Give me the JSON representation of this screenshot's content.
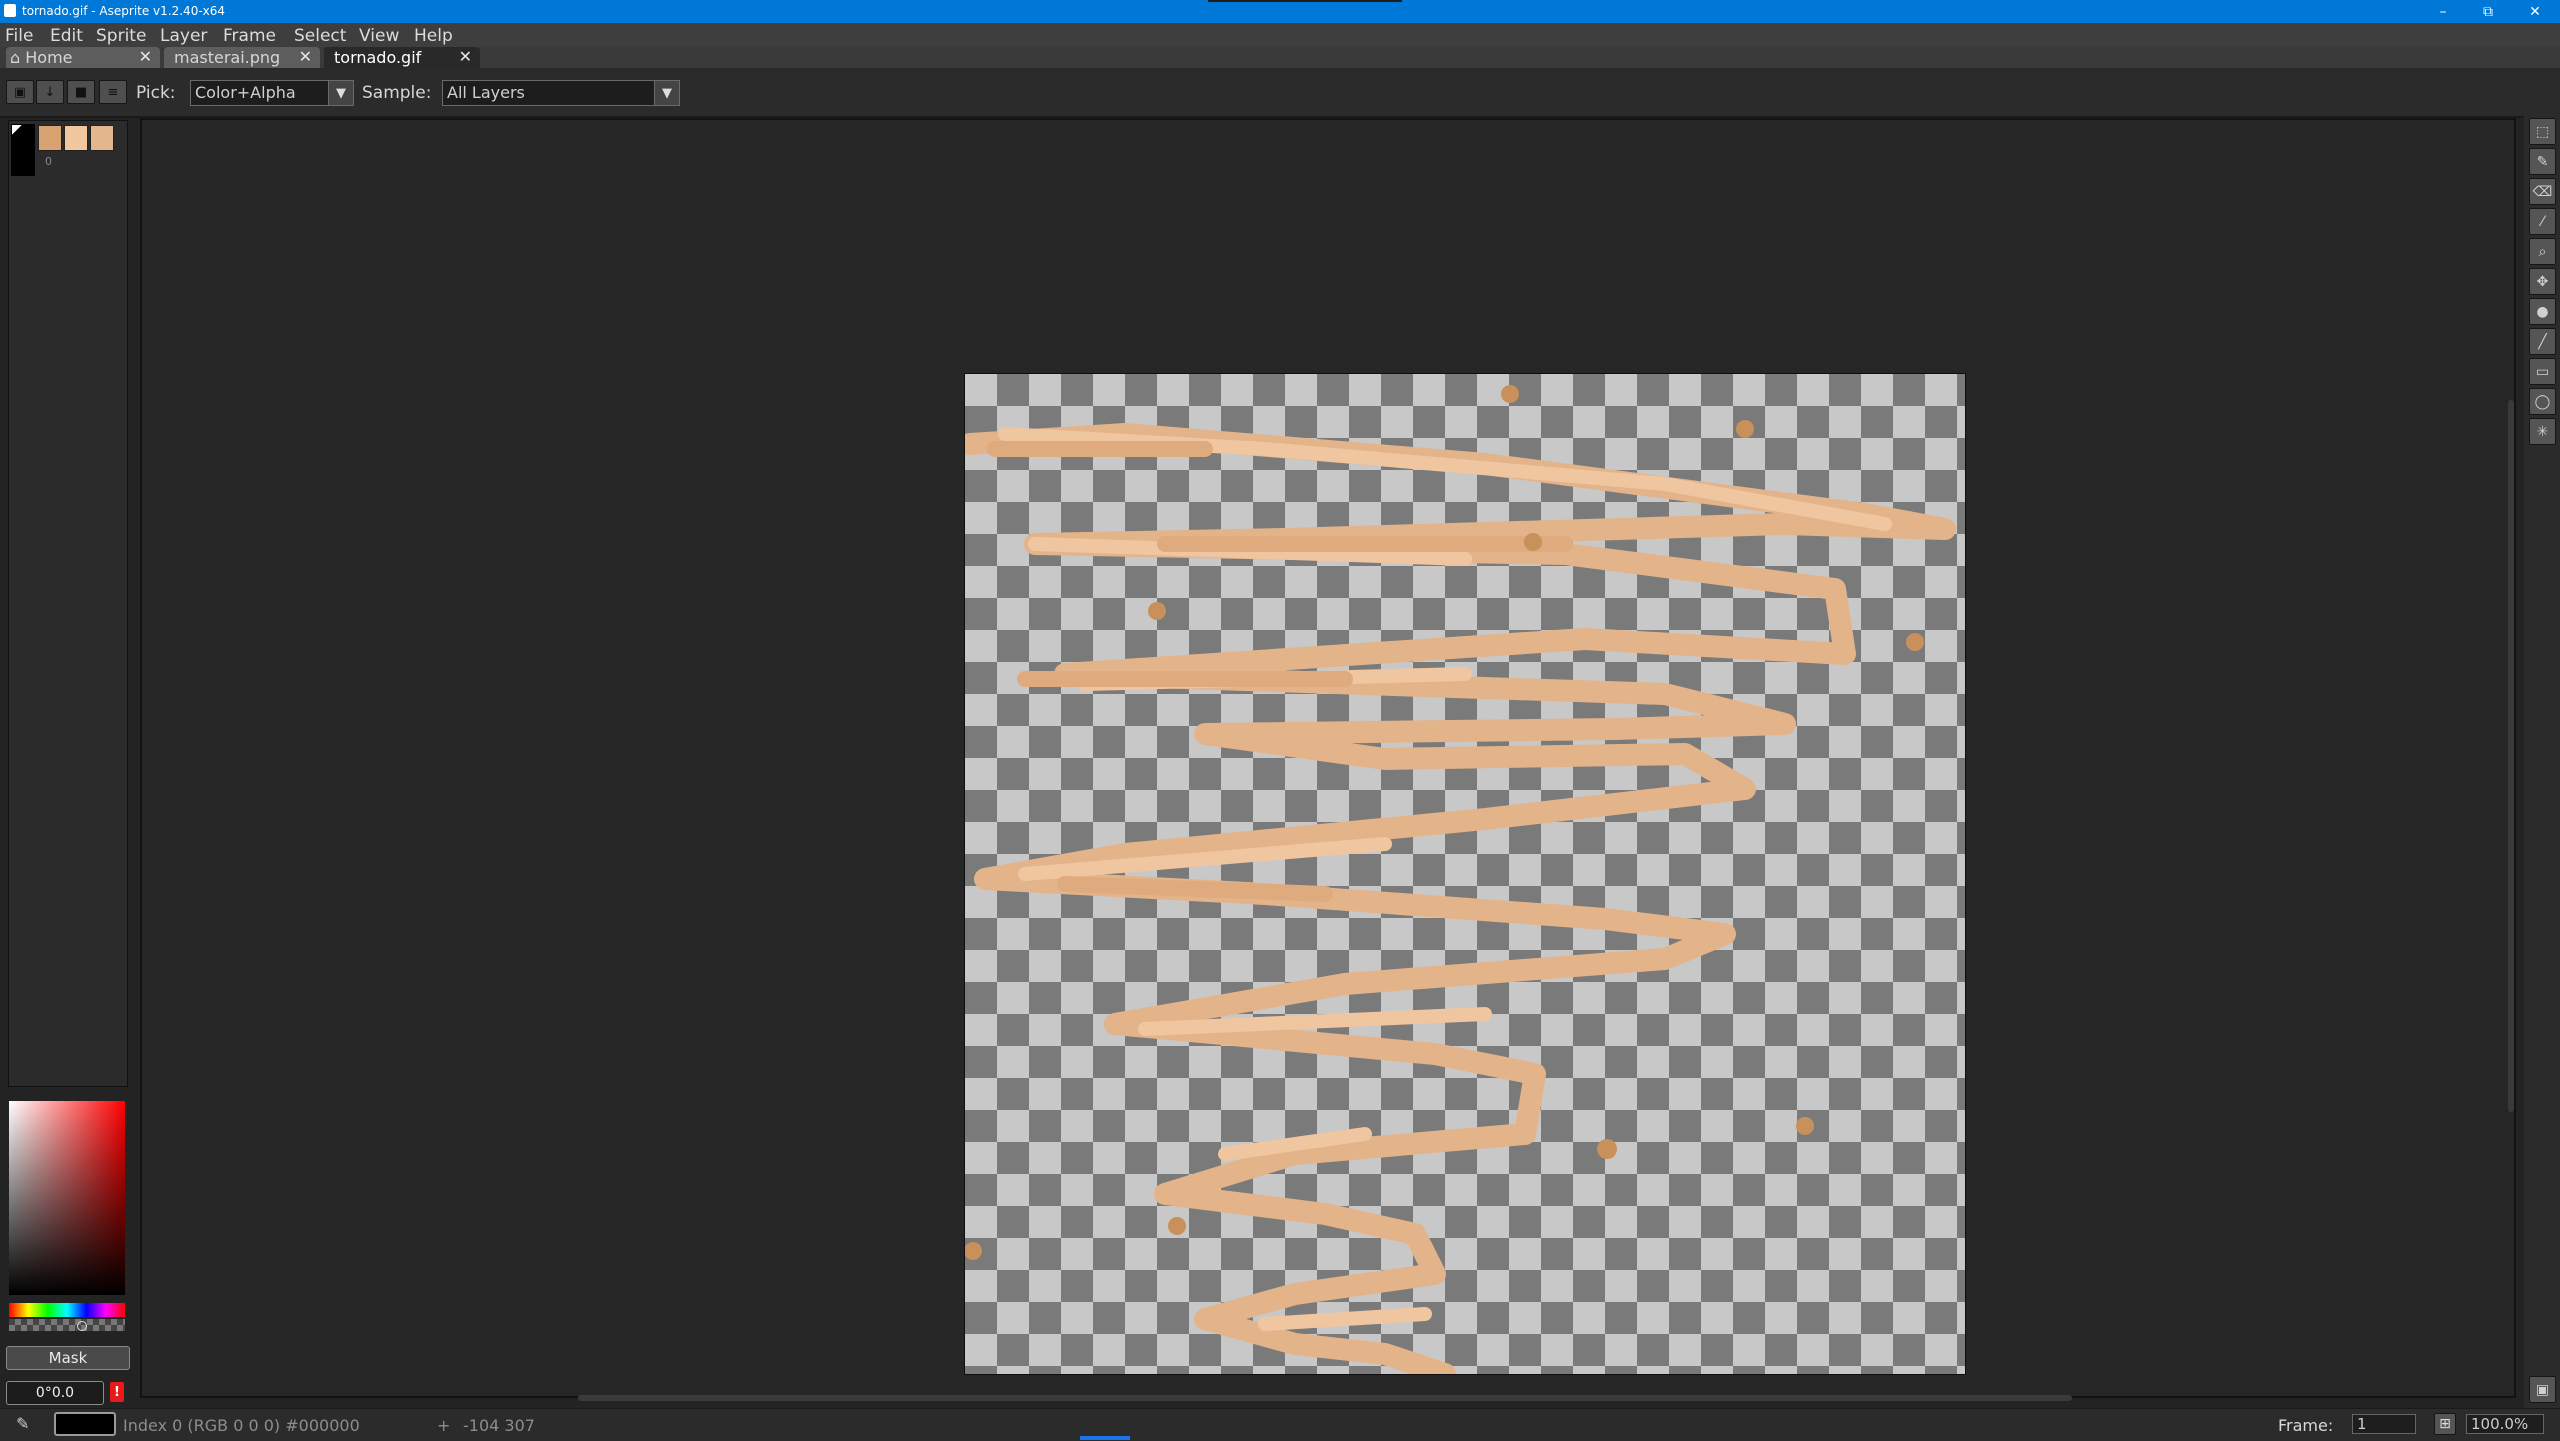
{
  "window": {
    "title": "tornado.gif - Aseprite v1.2.40-x64"
  },
  "window_controls": {
    "minimize": "–",
    "restore": "⧉",
    "close": "✕"
  },
  "menu": [
    "File",
    "Edit",
    "Sprite",
    "Layer",
    "Frame",
    "Select",
    "View",
    "Help"
  ],
  "tabs": [
    {
      "icon": "home-icon",
      "label": "Home",
      "close": "✕"
    },
    {
      "label": "masterai.png",
      "close": "✕"
    },
    {
      "label": "tornado.gif",
      "close": "✕",
      "active": true
    }
  ],
  "context_bar": {
    "pick_label": "Pick:",
    "pick_value": "Color+Alpha",
    "sample_label": "Sample:",
    "sample_value": "All Layers"
  },
  "palette": {
    "colors": [
      "#000000",
      "#d9a271",
      "#f0c79f",
      "#e3b78b"
    ],
    "index_text": "0"
  },
  "mask_label": "Mask",
  "angle_value": "0°0.0",
  "warning_symbol": "!",
  "status": {
    "color_info": "Index 0 (RGB 0 0 0) #000000",
    "cursor_pos": "-104 307",
    "frame_label": "Frame:",
    "frame_value": "1",
    "zoom": "100.0%"
  },
  "colors": {
    "accent": "#0078d7",
    "stroke_main": "#e3b48a",
    "stroke_light": "#f0c6a0",
    "dots": "#c8905a"
  },
  "tools": [
    "marquee-icon",
    "lasso-icon",
    "eraser-icon",
    "eyedropper-icon",
    "zoom-icon",
    "move-icon",
    "fill-icon",
    "line-icon",
    "rectangle-icon",
    "ellipse-icon",
    "contour-icon"
  ]
}
